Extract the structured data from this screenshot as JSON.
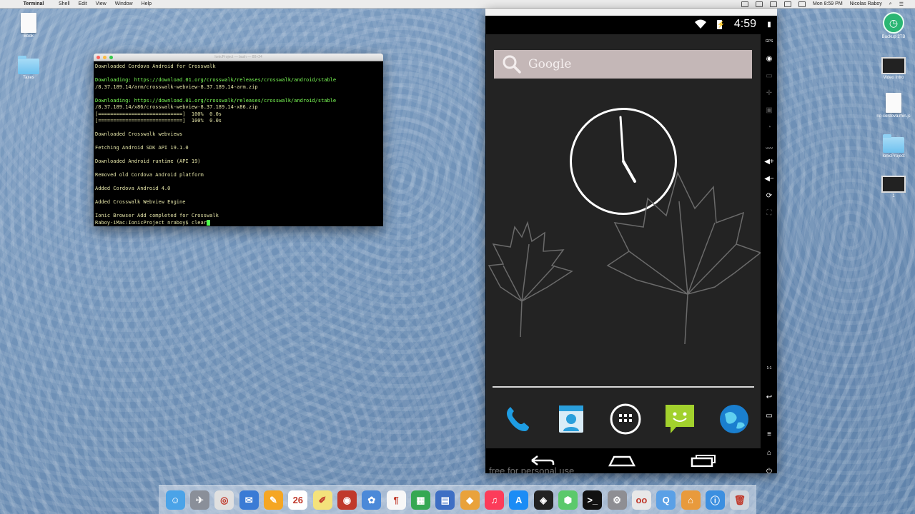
{
  "menubar": {
    "items": [
      "Terminal",
      "Shell",
      "Edit",
      "View",
      "Window",
      "Help"
    ],
    "clock": "Mon 8:59 PM",
    "user": "Nicolas Raboy"
  },
  "desktop_icons": {
    "book": "Book",
    "taxes": "Taxes",
    "backup": "Backup 2TB",
    "video_intro": "Video Intro",
    "ng_cordova": "ng-cordova.min.js",
    "ionic_project": "IonicProject",
    "screen_item": "1"
  },
  "terminal": {
    "title": "IonicProject — bash — 80×24",
    "lines": [
      {
        "text": "Downloaded Cordova Android for Crosswalk",
        "green": false
      },
      {
        "text": "",
        "green": false
      },
      {
        "text": "Downloading: https://download.01.org/crosswalk/releases/crosswalk/android/stable",
        "green": true
      },
      {
        "text": "/8.37.189.14/arm/crosswalk-webview-8.37.189.14-arm.zip",
        "green": false
      },
      {
        "text": "",
        "green": false
      },
      {
        "text": "Downloading: https://download.01.org/crosswalk/releases/crosswalk/android/stable",
        "green": true
      },
      {
        "text": "/8.37.189.14/x86/crosswalk-webview-8.37.189.14-x86.zip",
        "green": false
      },
      {
        "text": "[============================]  100%  0.0s",
        "green": false
      },
      {
        "text": "[============================]  100%  0.0s",
        "green": false
      },
      {
        "text": "",
        "green": false
      },
      {
        "text": "Downloaded Crosswalk webviews",
        "green": false
      },
      {
        "text": "",
        "green": false
      },
      {
        "text": "Fetching Android SDK API 19.1.0",
        "green": false
      },
      {
        "text": "",
        "green": false
      },
      {
        "text": "Downloaded Android runtime (API 19)",
        "green": false
      },
      {
        "text": "",
        "green": false
      },
      {
        "text": "Removed old Cordova Android platform",
        "green": false
      },
      {
        "text": "",
        "green": false
      },
      {
        "text": "Added Cordova Android 4.0",
        "green": false
      },
      {
        "text": "",
        "green": false
      },
      {
        "text": "Added Crosswalk Webview Engine",
        "green": false
      },
      {
        "text": "",
        "green": false
      },
      {
        "text": "Ionic Browser Add completed for Crosswalk",
        "green": false
      }
    ],
    "prompt": "Raboy-iMac:IonicProject nraboy$ clear"
  },
  "emulator": {
    "status_time": "4:59",
    "search_label": "Google",
    "watermark": "free for personal use",
    "clock_time": "4:59",
    "apps": [
      "phone-icon",
      "contacts-icon",
      "app-drawer-icon",
      "messaging-icon",
      "browser-icon"
    ],
    "sidebar_labels": {
      "gps": "GPS",
      "one_to_one": "1:1"
    }
  },
  "dock_apps": [
    "Finder",
    "Launchpad",
    "Chrome",
    "Preview",
    "Pages",
    "Calendar",
    "Notes",
    "Photo Booth",
    "Photos",
    "TextEdit",
    "Numbers",
    "Keynote",
    "Sketch",
    "iTunes",
    "App Store",
    "Unity",
    "Maps",
    "Terminal",
    "System Preferences",
    "Flickr",
    "QuickTime",
    "Home",
    "Installer",
    "Trash"
  ],
  "colors": {
    "terminal_green": "#7cff56",
    "terminal_text": "#e4e4a8",
    "android_bg": "#232323"
  }
}
